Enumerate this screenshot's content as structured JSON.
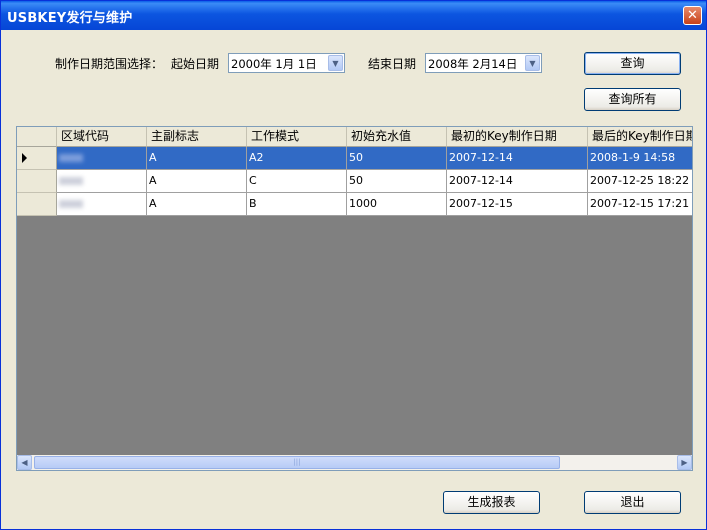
{
  "window": {
    "title": "USBKEY发行与维护",
    "close_glyph": "✕"
  },
  "filter": {
    "range_label": "制作日期范围选择：",
    "start_label": "起始日期",
    "start_date": "2000年 1月 1日",
    "end_label": "结束日期",
    "end_date": "2008年 2月14日"
  },
  "buttons": {
    "query": "查询",
    "query_all": "查询所有",
    "report": "生成报表",
    "exit": "退出"
  },
  "grid": {
    "columns": [
      "区域代码",
      "主副标志",
      "工作模式",
      "初始充水值",
      "最初的Key制作日期",
      "最后的Key制作日期"
    ],
    "rows": [
      {
        "region": "",
        "flag": "A",
        "mode": "A2",
        "initial": "50",
        "first_date": "2007-12-14",
        "last_date": "2008-1-9 14:58",
        "selected": true
      },
      {
        "region": "",
        "flag": "A",
        "mode": "C",
        "initial": "50",
        "first_date": "2007-12-14",
        "last_date": "2007-12-25 18:22",
        "selected": false
      },
      {
        "region": "",
        "flag": "A",
        "mode": "B",
        "initial": "1000",
        "first_date": "2007-12-15",
        "last_date": "2007-12-15 17:21",
        "selected": false
      }
    ],
    "scroll_thumb_glyph": "|||"
  },
  "icons": {
    "dropdown": "chevron-down-icon",
    "scroll_left": "arrow-left-icon",
    "scroll_right": "arrow-right-icon",
    "row_indicator": "current-row-icon"
  },
  "colors": {
    "title_bar": "#0c55e0",
    "selection": "#316ac5",
    "grid_bg": "#808080",
    "dialog_bg": "#ece9d8"
  }
}
